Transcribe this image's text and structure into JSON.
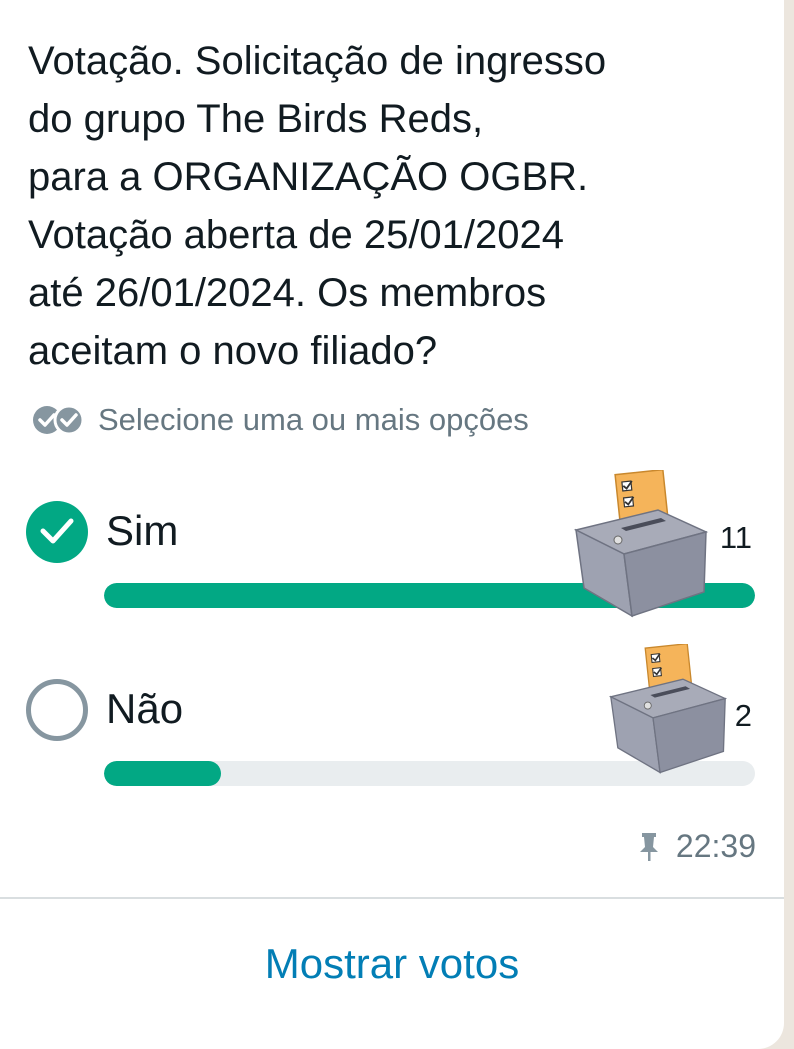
{
  "poll": {
    "question": "Votação. Solicitação de ingresso\ndo grupo The Birds Reds,\npara a ORGANIZAÇÃO OGBR.\nVotação aberta de 25/01/2024\naté 26/01/2024. Os membros\naceitam o novo filiado?",
    "hint": "Selecione uma ou mais opções",
    "hint_icon": "double-check-icon",
    "options": [
      {
        "label": "Sim",
        "votes": "11",
        "selected": true,
        "fraction": 1.0
      },
      {
        "label": "Não",
        "votes": "2",
        "selected": false,
        "fraction": 0.18
      }
    ],
    "time": "22:39",
    "pinned_icon": "pin-icon",
    "sticker_icon": "ballot-box-icon"
  },
  "actions": {
    "show_votes_label": "Mostrar votos"
  },
  "colors": {
    "accent_green": "#02a884",
    "link_blue": "#027eb5",
    "muted_gray": "#667781",
    "track_gray": "#e9edef"
  }
}
